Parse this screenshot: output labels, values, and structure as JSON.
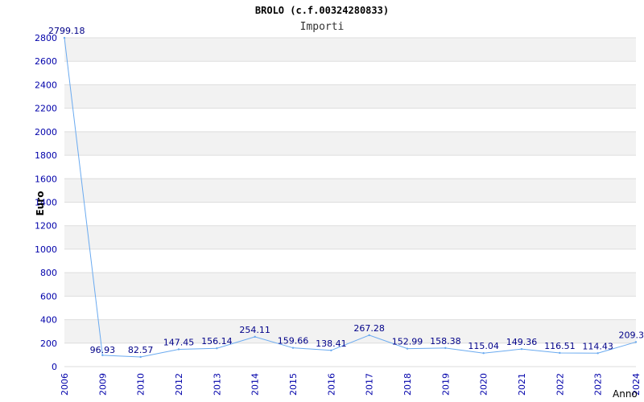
{
  "chart_data": {
    "type": "line",
    "title": "BROLO (c.f.00324280833)",
    "subtitle": "Importi",
    "xlabel": "Anno",
    "ylabel": "Euro",
    "categories": [
      "2006",
      "2009",
      "2010",
      "2012",
      "2013",
      "2014",
      "2015",
      "2016",
      "2017",
      "2018",
      "2019",
      "2020",
      "2021",
      "2022",
      "2023",
      "2024"
    ],
    "values": [
      2799.18,
      96.93,
      82.57,
      147.45,
      156.14,
      254.11,
      159.66,
      138.41,
      267.28,
      152.99,
      158.38,
      115.04,
      149.36,
      116.51,
      114.43,
      209.3
    ],
    "value_labels": [
      "2799.18",
      "96.93",
      "82.57",
      "147.45",
      "156.14",
      "254.11",
      "159.66",
      "138.41",
      "267.28",
      "152.99",
      "158.38",
      "115.04",
      "149.36",
      "116.51",
      "114.43",
      "209.3"
    ],
    "ylim": [
      0,
      2800
    ],
    "yticks": [
      0,
      200,
      400,
      600,
      800,
      1000,
      1200,
      1400,
      1600,
      1800,
      2000,
      2200,
      2400,
      2600,
      2800
    ],
    "grid": true,
    "colors": {
      "line": "#6aaaf0",
      "tick_text": "#0000aa",
      "label_text": "#000088",
      "band_fill": "#f2f2f2",
      "grid": "#dddddd"
    }
  }
}
